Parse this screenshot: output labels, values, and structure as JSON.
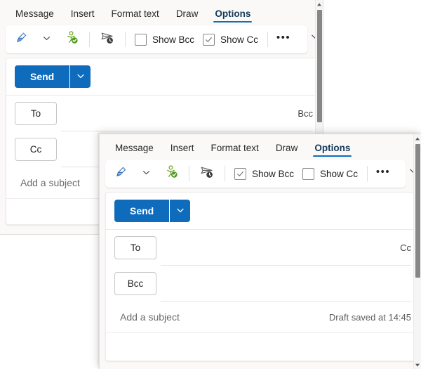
{
  "windows": [
    {
      "id": "window-back",
      "tabs": [
        {
          "label": "Message",
          "active": false
        },
        {
          "label": "Insert",
          "active": false
        },
        {
          "label": "Format text",
          "active": false
        },
        {
          "label": "Draw",
          "active": false
        },
        {
          "label": "Options",
          "active": true
        }
      ],
      "ribbon": {
        "signature_icon": "signature-pen-icon",
        "signature_caret": "chevron-down-icon",
        "permissions_icon": "permissions-person-check-icon",
        "delay_delivery_icon": "send-later-clock-icon",
        "checkboxes": [
          {
            "label": "Show Bcc",
            "checked": false,
            "name": "show-bcc"
          },
          {
            "label": "Show Cc",
            "checked": true,
            "name": "show-cc"
          }
        ],
        "more_label": "•••",
        "more_name": "more-options-icon",
        "collapse_icon": "chevron-down-icon"
      },
      "compose": {
        "send_label": "Send",
        "send_caret_icon": "chevron-down-icon",
        "rows": [
          {
            "pill": "To",
            "link": "Bcc",
            "value": ""
          },
          {
            "pill": "Cc",
            "link": "",
            "value": ""
          }
        ],
        "subject_placeholder": "Add a subject",
        "draft_status": ""
      },
      "scrollbar": {
        "up_icon": "caret-up-icon",
        "down_icon": "caret-down-icon"
      }
    },
    {
      "id": "window-front",
      "tabs": [
        {
          "label": "Message",
          "active": false
        },
        {
          "label": "Insert",
          "active": false
        },
        {
          "label": "Format text",
          "active": false
        },
        {
          "label": "Draw",
          "active": false
        },
        {
          "label": "Options",
          "active": true
        }
      ],
      "ribbon": {
        "signature_icon": "signature-pen-icon",
        "signature_caret": "chevron-down-icon",
        "permissions_icon": "permissions-person-check-icon",
        "delay_delivery_icon": "send-later-clock-icon",
        "checkboxes": [
          {
            "label": "Show Bcc",
            "checked": true,
            "name": "show-bcc"
          },
          {
            "label": "Show Cc",
            "checked": false,
            "name": "show-cc"
          }
        ],
        "more_label": "•••",
        "more_name": "more-options-icon",
        "collapse_icon": "chevron-down-icon"
      },
      "compose": {
        "send_label": "Send",
        "send_caret_icon": "chevron-down-icon",
        "rows": [
          {
            "pill": "To",
            "link": "Cc",
            "value": ""
          },
          {
            "pill": "Bcc",
            "link": "",
            "value": ""
          }
        ],
        "subject_placeholder": "Add a subject",
        "draft_status": "Draft saved at 14:45"
      },
      "scrollbar": {
        "up_icon": "caret-up-icon",
        "down_icon": "caret-down-icon"
      }
    }
  ],
  "colors": {
    "accent": "#0f6cbd",
    "window_bg": "#faf9f8",
    "card_bg": "#ffffff",
    "border": "#e1dfdd",
    "text": "#201f1e",
    "muted_text": "#6b6b6b"
  }
}
